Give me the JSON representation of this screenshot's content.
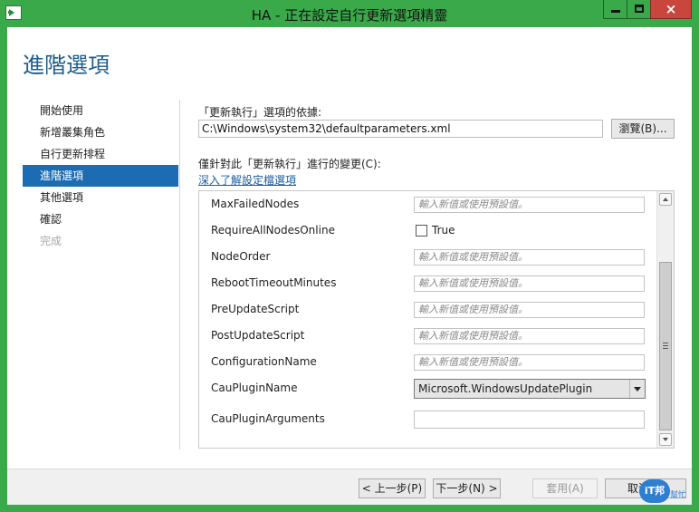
{
  "window": {
    "title": "HA - 正在設定自行更新選項精靈",
    "close_glyph": "×"
  },
  "page": {
    "title": "進階選項"
  },
  "nav": {
    "items": [
      {
        "label": "開始使用",
        "state": "normal"
      },
      {
        "label": "新增叢集角色",
        "state": "normal"
      },
      {
        "label": "自行更新排程",
        "state": "normal"
      },
      {
        "label": "進階選項",
        "state": "active"
      },
      {
        "label": "其他選項",
        "state": "normal"
      },
      {
        "label": "確認",
        "state": "normal"
      },
      {
        "label": "完成",
        "state": "disabled"
      }
    ]
  },
  "options": {
    "basis_label": "「更新執行」選項的依據:",
    "path_value": "C:\\Windows\\system32\\defaultparameters.xml",
    "browse_label": "瀏覽(B)...",
    "changes_label": "僅針對此「更新執行」進行的變更(C):",
    "learn_more_link": "深入了解設定檔選項"
  },
  "grid": {
    "placeholder": "輸入新值或使用預設值。",
    "rows": [
      {
        "name": "MaxFailedNodes",
        "kind": "input"
      },
      {
        "name": "RequireAllNodesOnline",
        "kind": "checkbox",
        "checkbox_label": "True",
        "checked": false
      },
      {
        "name": "NodeOrder",
        "kind": "input"
      },
      {
        "name": "RebootTimeoutMinutes",
        "kind": "input"
      },
      {
        "name": "PreUpdateScript",
        "kind": "input"
      },
      {
        "name": "PostUpdateScript",
        "kind": "input"
      },
      {
        "name": "ConfigurationName",
        "kind": "input"
      },
      {
        "name": "CauPluginName",
        "kind": "select",
        "value": "Microsoft.WindowsUpdatePlugin"
      },
      {
        "name": "CauPluginArguments",
        "kind": "plain-input",
        "value": ""
      }
    ]
  },
  "footer": {
    "prev_label": "< 上一步(P)",
    "next_label": "下一步(N) >",
    "apply_label": "套用(A)",
    "cancel_label": "取消"
  },
  "watermark": {
    "badge": "iT邦",
    "sub": "幫忙"
  },
  "colors": {
    "frame": "#39a94a",
    "accent": "#1c6cb3",
    "title_blue": "#1c5d8f",
    "close_red": "#c9463d"
  }
}
